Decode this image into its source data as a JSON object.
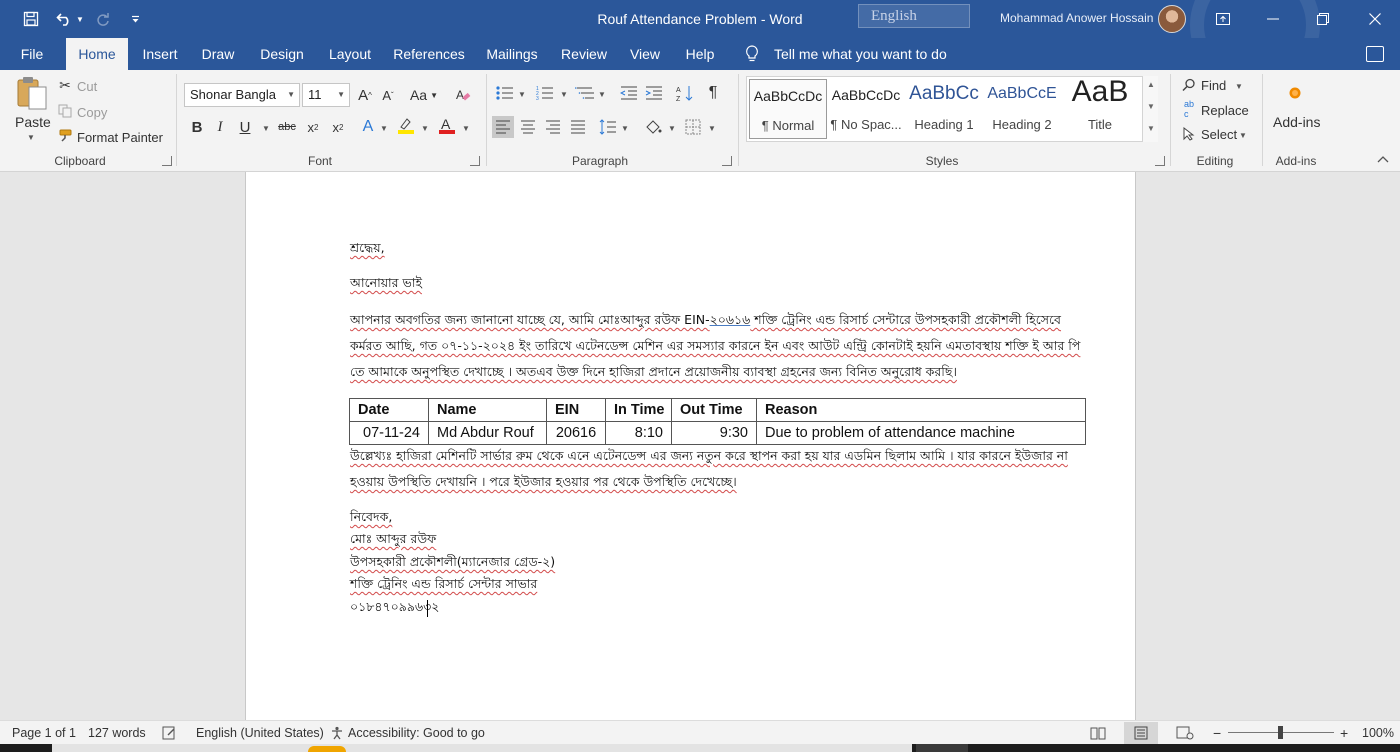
{
  "title_bar": {
    "title": "Rouf Attendance Problem  -  Word",
    "language": "English",
    "user_name": "Mohammad Anower Hossain"
  },
  "tabs": [
    {
      "label": "File"
    },
    {
      "label": "Home"
    },
    {
      "label": "Insert"
    },
    {
      "label": "Draw"
    },
    {
      "label": "Design"
    },
    {
      "label": "Layout"
    },
    {
      "label": "References"
    },
    {
      "label": "Mailings"
    },
    {
      "label": "Review"
    },
    {
      "label": "View"
    },
    {
      "label": "Help"
    }
  ],
  "active_tab": "Home",
  "tell_me": "Tell me what you want to do",
  "ribbon": {
    "clipboard": {
      "label": "Clipboard",
      "paste": "Paste",
      "cut": "Cut",
      "copy": "Copy",
      "format_painter": "Format Painter"
    },
    "font": {
      "label": "Font",
      "font_name": "Shonar Bangla",
      "font_size": "11"
    },
    "paragraph": {
      "label": "Paragraph"
    },
    "styles": {
      "label": "Styles",
      "items": [
        {
          "sample": "AaBbCcDc",
          "name": "¶ Normal"
        },
        {
          "sample": "AaBbCcDc",
          "name": "¶ No Spac..."
        },
        {
          "sample": "AaBbCc",
          "name": "Heading 1"
        },
        {
          "sample": "AaBbCcE",
          "name": "Heading 2"
        },
        {
          "sample": "AaB",
          "name": "Title"
        }
      ]
    },
    "editing": {
      "label": "Editing",
      "find": "Find",
      "replace": "Replace",
      "select": "Select"
    },
    "addins": {
      "label": "Add-ins",
      "button": "Add-ins"
    }
  },
  "document": {
    "salutation": "শ্রদ্ধেয়,",
    "addressee": "আনোয়ার ভাই",
    "intro_lines": [
      {
        "pre": "আপনার অবগতির জন্য জানানো যাচ্ছে যে, আমি মোঃআব্দুর রউফ EIN-",
        "ein": "২০৬১৬",
        "post": "  শক্তি ট্রেনিং এন্ড রিসার্চ সেন্টারে উপসহকারী প্রকৌশলী   হিসেবে"
      },
      {
        "pre": "কর্মরত আছি, গত ০৭-১১-২০২৪ ইং তারিখে এটেনডেন্স মেশিন এর সমস্যার কারনে ইন এবং আউট এন্ট্রি কোনটাই হয়নি এমতাবস্থায় শক্তি ই আর পি",
        "ein": "",
        "post": ""
      },
      {
        "pre": "তে আমাকে অনুপস্থিত দেখাচ্ছে । অতএব উক্ত দিনে হাজিরা প্রদানে প্রয়োজনীয় ব্যাবস্থা গ্রহনের জন্য বিনিত অনুরোধ করছি।",
        "ein": "",
        "post": ""
      }
    ],
    "table": {
      "headers": [
        "Date",
        "Name",
        "EIN",
        "In Time",
        "Out Time",
        "Reason"
      ],
      "rows": [
        [
          "07-11-24",
          "Md Abdur Rouf",
          "20616",
          "8:10",
          "9:30",
          "Due to problem of attendance machine"
        ]
      ]
    },
    "note_lines": [
      "উল্লেখ্যঃ হাজিরা মেশিনটি সার্ভার রুম থেকে এনে এটেনডেন্স এর জন্য নতুন করে স্থাপন করা হয় যার এডমিন ছিলাম আমি । যার কারনে ইউজার না",
      "হওয়ায় উপস্থিতি দেখায়নি । পরে ইউজার হওয়ার পর থেকে উপস্থিতি দেখেচ্ছে।"
    ],
    "signature_lines": [
      "নিবেদক,",
      "মোঃ আব্দুর রউফ",
      "উপসহকারী প্রকৌশলী(ম্যানেজার গ্রেড-২)",
      "শক্তি ট্রেনিং এন্ড রিসার্চ সেন্টার সাভার",
      "০১৮৪৭০৯৯৬৩২"
    ]
  },
  "status_bar": {
    "page": "Page 1 of 1",
    "words": "127 words",
    "language": "English (United States)",
    "accessibility": "Accessibility: Good to go",
    "zoom": "100%"
  },
  "colors": {
    "title_bar": "#2b579a",
    "ribbon_bg": "#f3f3f3",
    "doc_bg": "#e6e6e6",
    "page": "#ffffff",
    "spell_underline": "#d24a4a"
  }
}
